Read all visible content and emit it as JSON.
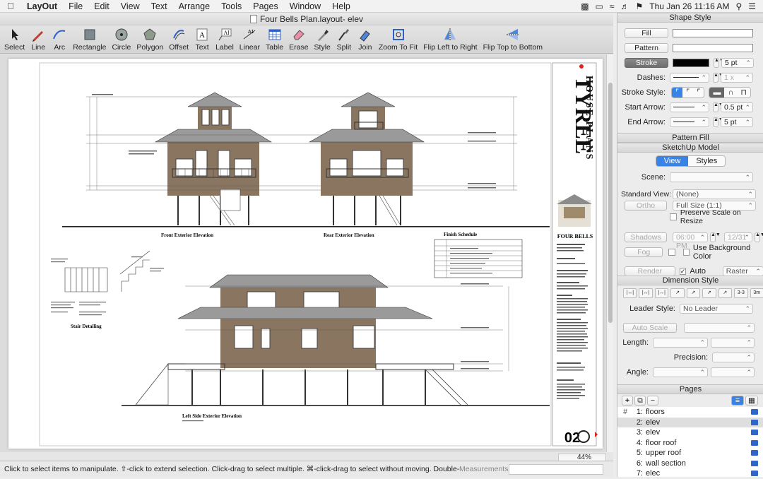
{
  "menubar": {
    "app_name": "LayOut",
    "items": [
      "File",
      "Edit",
      "View",
      "Text",
      "Arrange",
      "Tools",
      "Pages",
      "Window",
      "Help"
    ],
    "clock": "Thu Jan 26  11:16 AM"
  },
  "window": {
    "title": "Four Bells Plan.layout- elev"
  },
  "toolbar": {
    "tools": [
      "Select",
      "Line",
      "Arc",
      "Rectangle",
      "Circle",
      "Polygon",
      "Offset",
      "Text",
      "Label",
      "Linear",
      "Table",
      "Erase",
      "Style",
      "Split",
      "Join",
      "Zoom To Fit",
      "Flip Left to Right",
      "Flip Top to Bottom"
    ]
  },
  "drawing": {
    "front_elevation": "Front Exterior Elevation",
    "rear_elevation": "Rear Exterior Elevation",
    "finish_schedule": "Finish Schedule",
    "stair_detailing": "Stair Detailing",
    "left_side_elevation": "Left Side Exterior Elevation",
    "brand_line1": "TYREE",
    "brand_line2": "HOUSE PLANS",
    "model_name": "FOUR BELLS",
    "sheet_number": "02"
  },
  "status": {
    "message": "Click to select items to manipulate. ⇧-click to extend selection. Click-drag to select multiple. ⌘-click-drag to select without moving. Double-click to open e...",
    "measurements_label": "Measurements",
    "zoom": "44%"
  },
  "shape_style": {
    "header": "Shape Style",
    "fill_label": "Fill",
    "pattern_label": "Pattern",
    "stroke_label": "Stroke",
    "stroke_width": "5 pt",
    "dashes_label": "Dashes:",
    "dash_scale": "1 x",
    "stroke_style_label": "Stroke Style:",
    "start_arrow_label": "Start Arrow:",
    "start_arrow_size": "0.5 pt",
    "end_arrow_label": "End Arrow:",
    "end_arrow_size": "5 pt"
  },
  "pattern_fill": {
    "header": "Pattern Fill"
  },
  "sketchup_model": {
    "header": "SketchUp Model",
    "tab_view": "View",
    "tab_styles": "Styles",
    "scene_label": "Scene:",
    "standard_view_label": "Standard View:",
    "standard_view_value": "(None)",
    "ortho_label": "Ortho",
    "scale_value": "Full Size (1:1)",
    "preserve_scale": "Preserve Scale on Resize",
    "shadows_label": "Shadows",
    "shadow_time": "06:00 PM",
    "shadow_date": "12/31",
    "fog_label": "Fog",
    "use_background": "Use Background Color",
    "render_label": "Render",
    "auto_label": "Auto",
    "render_mode": "Raster"
  },
  "dimension_style": {
    "header": "Dimension Style",
    "leader_style_label": "Leader Style:",
    "leader_style_value": "No Leader",
    "auto_scale_label": "Auto Scale",
    "length_label": "Length:",
    "precision_label": "Precision:",
    "angle_label": "Angle:"
  },
  "pages": {
    "header": "Pages",
    "list": [
      {
        "num": "1:",
        "name": "floors",
        "active": false
      },
      {
        "num": "2:",
        "name": "elev",
        "active": true
      },
      {
        "num": "3:",
        "name": "elev",
        "active": false
      },
      {
        "num": "4:",
        "name": "floor roof",
        "active": false
      },
      {
        "num": "5:",
        "name": "upper roof",
        "active": false
      },
      {
        "num": "6:",
        "name": "wall section",
        "active": false
      },
      {
        "num": "7:",
        "name": "elec",
        "active": false
      }
    ]
  }
}
